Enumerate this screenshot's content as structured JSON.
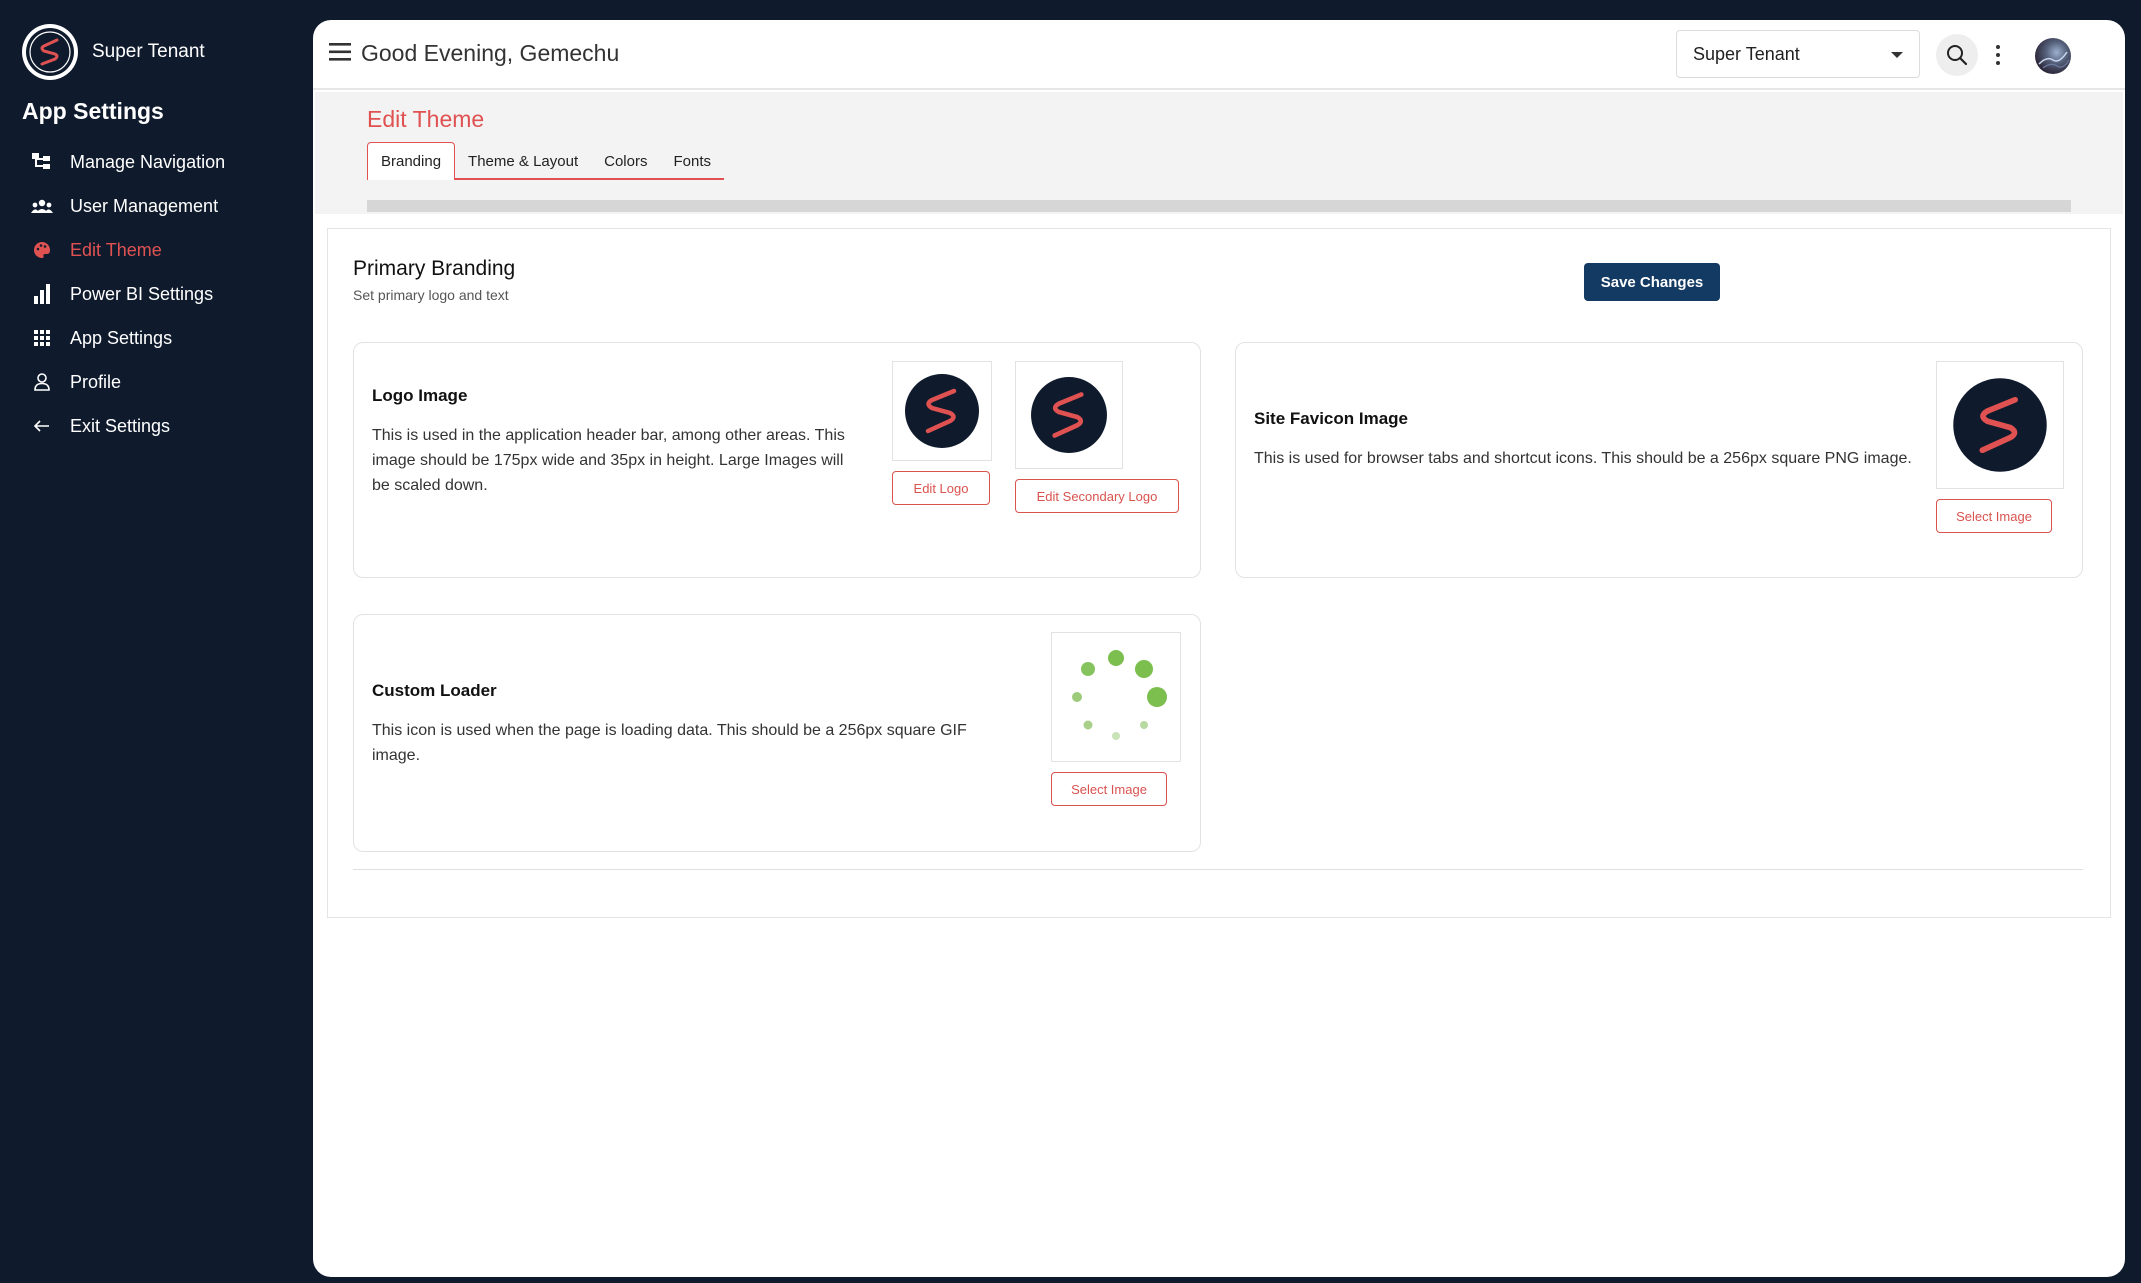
{
  "sidebar": {
    "brand_name": "Super Tenant",
    "title": "App Settings",
    "items": [
      {
        "label": "Manage Navigation",
        "icon": "sitemap-icon"
      },
      {
        "label": "User Management",
        "icon": "users-icon"
      },
      {
        "label": "Edit Theme",
        "icon": "palette-icon",
        "active": true
      },
      {
        "label": "Power BI Settings",
        "icon": "bar-chart-icon"
      },
      {
        "label": "App Settings",
        "icon": "grid-icon"
      },
      {
        "label": "Profile",
        "icon": "person-icon"
      },
      {
        "label": "Exit Settings",
        "icon": "arrow-left-icon"
      }
    ]
  },
  "header": {
    "greeting": "Good Evening, Gemechu",
    "tenant_selected": "Super Tenant"
  },
  "page": {
    "title": "Edit Theme",
    "tabs": [
      {
        "label": "Branding",
        "active": true
      },
      {
        "label": "Theme & Layout"
      },
      {
        "label": "Colors"
      },
      {
        "label": "Fonts"
      }
    ]
  },
  "branding": {
    "title": "Primary Branding",
    "subtitle": "Set primary logo and text",
    "save_label": "Save Changes",
    "logo_card": {
      "title": "Logo Image",
      "description": "This is used in the application header bar, among other areas. This image should be 175px wide and 35px in height. Large Images will be scaled down.",
      "edit_logo_label": "Edit Logo",
      "edit_secondary_label": "Edit Secondary Logo"
    },
    "favicon_card": {
      "title": "Site Favicon Image",
      "description": "This is used for browser tabs and shortcut icons. This should be a 256px square PNG image.",
      "select_label": "Select Image"
    },
    "loader_card": {
      "title": "Custom Loader",
      "description": "This icon is used when the page is loading data. This should be a 256px square GIF image.",
      "select_label": "Select Image"
    }
  },
  "colors": {
    "sidebar_bg": "#0f1b2d",
    "accent": "#e05252",
    "primary_button": "#133a62",
    "loader_green": "#7cbf4f"
  }
}
